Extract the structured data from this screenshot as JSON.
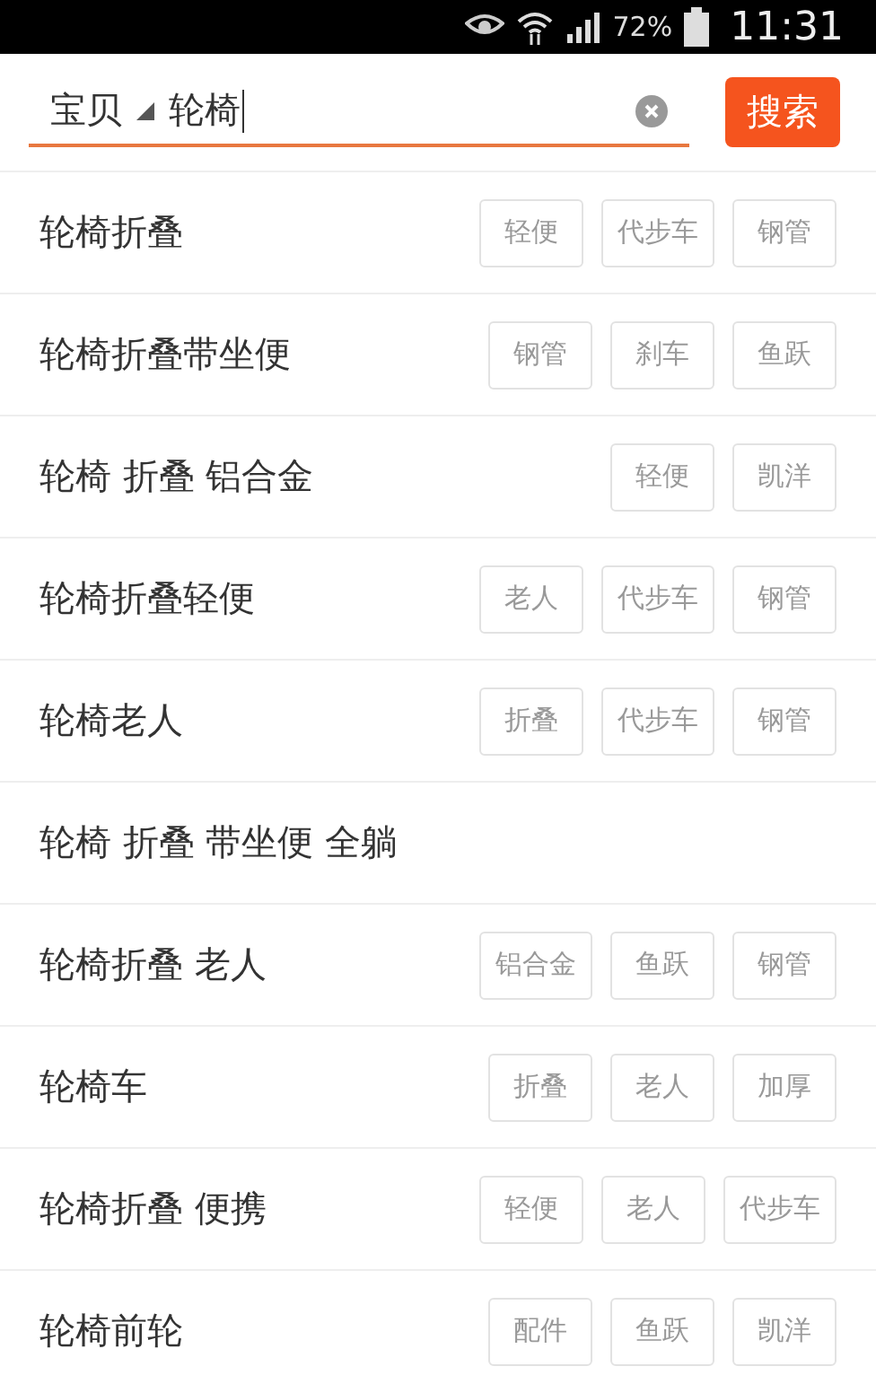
{
  "status_bar": {
    "battery": "72%",
    "time": "11:31"
  },
  "search": {
    "scope": "宝贝",
    "value": "轮椅",
    "button": "搜索"
  },
  "suggestions": [
    {
      "text": "轮椅折叠",
      "tags": [
        "轻便",
        "代步车",
        "钢管"
      ]
    },
    {
      "text": "轮椅折叠带坐便",
      "tags": [
        "钢管",
        "刹车",
        "鱼跃"
      ]
    },
    {
      "text": "轮椅 折叠 铝合金",
      "tags": [
        "轻便",
        "凯洋"
      ]
    },
    {
      "text": "轮椅折叠轻便",
      "tags": [
        "老人",
        "代步车",
        "钢管"
      ]
    },
    {
      "text": "轮椅老人",
      "tags": [
        "折叠",
        "代步车",
        "钢管"
      ]
    },
    {
      "text": "轮椅 折叠 带坐便 全躺"
    },
    {
      "text": "轮椅折叠 老人",
      "tags": [
        "铝合金",
        "鱼跃",
        "钢管"
      ]
    },
    {
      "text": "轮椅车",
      "tags": [
        "折叠",
        "老人",
        "加厚"
      ]
    },
    {
      "text": "轮椅折叠 便携",
      "tags": [
        "轻便",
        "老人",
        "代步车"
      ]
    },
    {
      "text": "轮椅前轮",
      "tags": [
        "配件",
        "鱼跃",
        "凯洋"
      ]
    }
  ]
}
